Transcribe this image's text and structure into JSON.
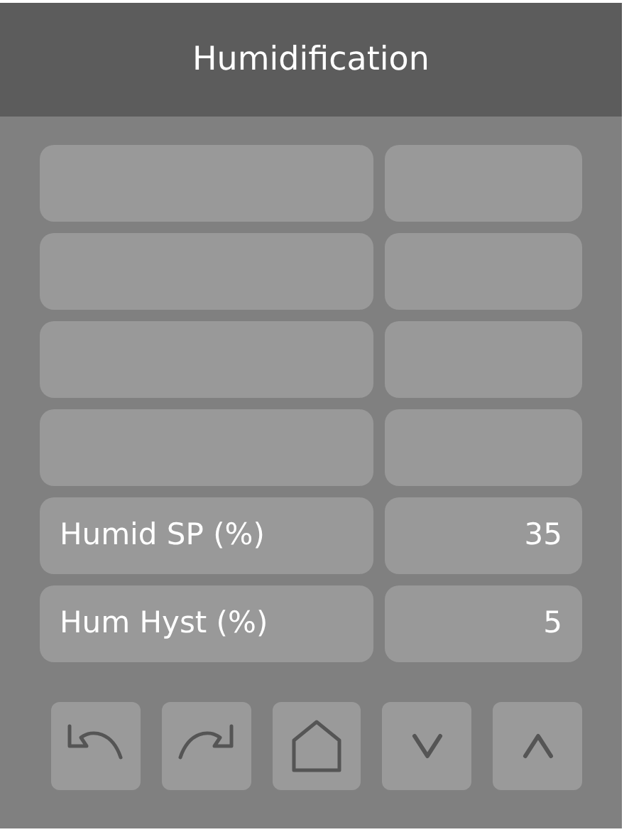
{
  "header": {
    "title": "Humidification"
  },
  "rows": [
    {
      "kind": "blank"
    },
    {
      "kind": "blank"
    },
    {
      "kind": "blank"
    },
    {
      "kind": "blank"
    },
    {
      "kind": "setting",
      "label": "Humid SP (%)",
      "value": "35"
    },
    {
      "kind": "setting",
      "label": "Hum Hyst (%)",
      "value": "5"
    }
  ],
  "nav_buttons": [
    {
      "kind": "back"
    },
    {
      "kind": "forward"
    },
    {
      "kind": "home"
    },
    {
      "kind": "down"
    },
    {
      "kind": "up"
    }
  ]
}
